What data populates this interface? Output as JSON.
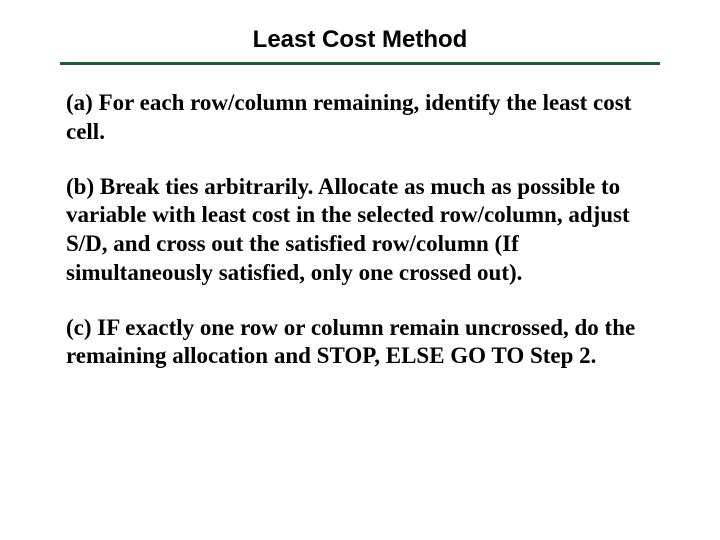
{
  "title": "Least Cost Method",
  "paragraphs": {
    "a": "(a) For each row/column remaining, identify the least cost cell.",
    "b": "(b) Break ties arbitrarily. Allocate as much as possible to variable with least cost in the selected row/column, adjust S/D, and cross out the satisfied row/column (If simultaneously satisfied, only one crossed out).",
    "c": "(c) IF exactly one row or column remain uncrossed, do the remaining allocation and STOP, ELSE GO TO Step 2."
  }
}
